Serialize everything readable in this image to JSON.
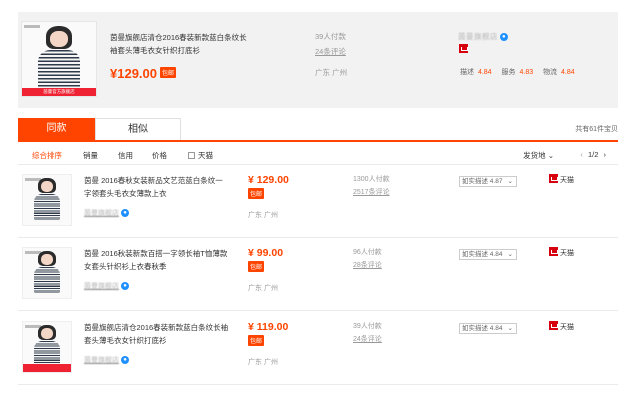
{
  "top": {
    "title": "茵曼旗舰店清仓2016春装新款蓝白条纹长袖套头薄毛衣女针织打底衫",
    "price": "¥129.00",
    "baoyou": "包邮",
    "sales": "39人付款",
    "comments": "24条评论",
    "location": "广东 广州",
    "shop": "茵曼旗舰店",
    "image_badge": "茵曼官方旗舰店",
    "ratings": [
      {
        "label": "描述",
        "value": "4.84"
      },
      {
        "label": "服务",
        "value": "4.83"
      },
      {
        "label": "物流",
        "value": "4.84"
      }
    ]
  },
  "tabs": {
    "same": "同款",
    "similar": "相似",
    "count": "共有61件宝贝"
  },
  "sortbar": {
    "comprehensive": "综合排序",
    "sales": "销量",
    "credit": "信用",
    "price": "价格",
    "tmall": "天猫",
    "shipping": "发货地",
    "page": "1/2"
  },
  "results": [
    {
      "title": "茵曼 2016春秋女装新品文艺范蓝白条纹一字领套头毛衣女薄款上衣",
      "shop": "茵曼旗舰店",
      "price": "¥ 129.00",
      "baoyou": "包邮",
      "location": "广东 广州",
      "sales": "1300人付款",
      "comments": "2517条评论",
      "select": "如实描述 4.87",
      "tmall": "天猫"
    },
    {
      "title": "茵曼 2016秋装新款百搭一字领长袖T恤薄款女套头针织衫上衣春秋季",
      "shop": "茵曼旗舰店",
      "price": "¥ 99.00",
      "baoyou": "包邮",
      "location": "广东 广州",
      "sales": "96人付款",
      "comments": "28条评论",
      "select": "如实描述 4.84",
      "tmall": "天猫"
    },
    {
      "title": "茵曼旗舰店清仓2016春装新款蓝白条纹长袖套头薄毛衣女针织打底衫",
      "shop": "茵曼旗舰店",
      "price": "¥ 119.00",
      "baoyou": "包邮",
      "location": "广东 广州",
      "sales": "39人付款",
      "comments": "24条评论",
      "select": "如实描述 4.84",
      "tmall": "天猫"
    }
  ],
  "colors": {
    "accent": "#ff4400",
    "tmall_red": "#d7000f",
    "wangwang_blue": "#1e90ff"
  },
  "icons": {
    "wangwang": "wangwang-icon",
    "tmall": "tmall-icon",
    "chevron_left": "chevron-left-icon",
    "chevron_right": "chevron-right-icon"
  }
}
